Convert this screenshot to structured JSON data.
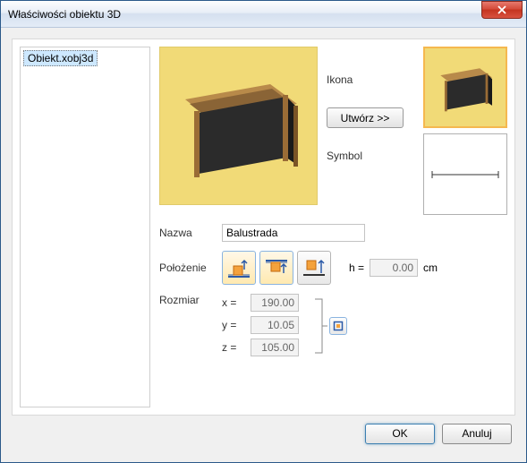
{
  "window": {
    "title": "Właściwości obiektu 3D"
  },
  "sidebar": {
    "items": [
      {
        "label": "Obiekt.xobj3d"
      }
    ]
  },
  "labels": {
    "icon": "Ikona",
    "symbol": "Symbol",
    "name": "Nazwa",
    "position": "Położenie",
    "size": "Rozmiar"
  },
  "buttons": {
    "create": "Utwórz >>",
    "ok": "OK",
    "cancel": "Anuluj"
  },
  "fields": {
    "name_value": "Balustrada",
    "h_label": "h  =",
    "h_value": "0.00",
    "h_unit": "cm",
    "x_label": "x =",
    "x_value": "190.00",
    "y_label": "y =",
    "y_value": "10.05",
    "z_label": "z =",
    "z_value": "105.00"
  },
  "icons": {
    "pos_bottom": "position-bottom-icon",
    "pos_top": "position-top-icon",
    "pos_center": "position-center-icon",
    "lock": "lock-aspect-icon"
  }
}
